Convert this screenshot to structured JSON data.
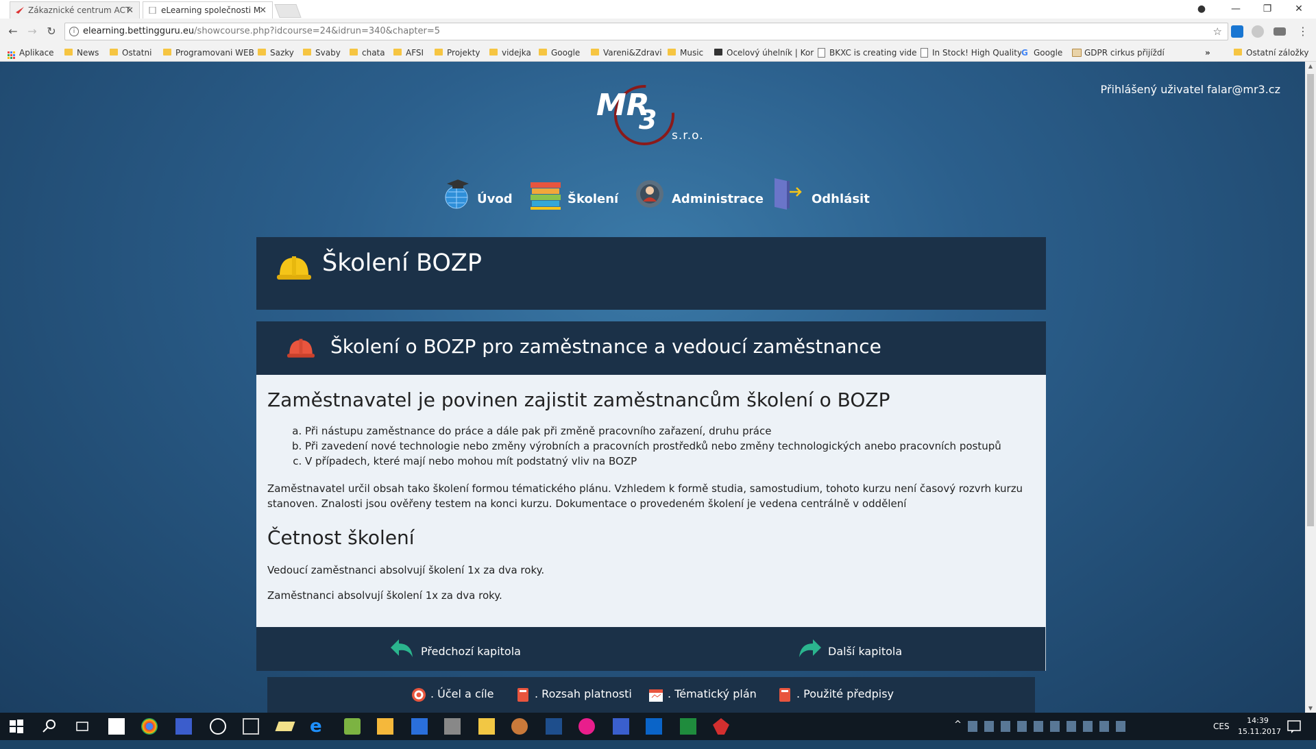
{
  "browser": {
    "tabs": [
      {
        "label": "Zákaznické centrum ACT",
        "active": false
      },
      {
        "label": "eLearning společnosti M",
        "active": true
      }
    ],
    "url_host": "elearning.bettingguru.eu",
    "url_path": "/showcourse.php?idcourse=24&idrun=340&chapter=5",
    "bookmarks": [
      "Aplikace",
      "News",
      "Ostatni",
      "Programovani WEB",
      "Sazky",
      "Svaby",
      "chata",
      "AFSI",
      "Projekty",
      "videjka",
      "Google",
      "Vareni&Zdravi",
      "Music",
      "Ocelový úhelník | Kor",
      "BKXC is creating vide",
      "In Stock! High Quality",
      "Google",
      "GDPR cirkus přijíždí",
      "»",
      "Ostatní záložky"
    ]
  },
  "header": {
    "user_text": "Přihlášený uživatel falar@mr3.cz",
    "logo_text": "MR3",
    "logo_sub": "s.r.o.",
    "nav": [
      {
        "label": "Úvod",
        "icon": "globe-cap-icon"
      },
      {
        "label": "Školení",
        "icon": "books-icon"
      },
      {
        "label": "Administrace",
        "icon": "admin-gear-icon"
      },
      {
        "label": "Odhlásit",
        "icon": "door-exit-icon"
      }
    ]
  },
  "course": {
    "title": "Školení BOZP",
    "chapter_title": "Školení o BOZP pro zaměstnance a vedoucí zaměstnance",
    "heading": "Zaměstnavatel je povinen zajistit zaměstnancům školení o BOZP",
    "list": [
      "Při nástupu zaměstnance do práce a dále pak při změně pracovního zařazení, druhu práce",
      "Při zavedení nové technologie nebo změny výrobních a pracovních prostředků nebo změny technologických anebo pracovních postupů",
      " V případech, které mají nebo mohou mít podstatný vliv na BOZP"
    ],
    "paragraph": "Zaměstnavatel určil obsah tako školení formou tématického plánu. Vzhledem k formě studia, samostudium, tohoto kurzu není časový rozvrh kurzu stanoven. Znalosti jsou ověřeny testem na konci kurzu. Dokumentace o provedeném školení je vedena centrálně v oddělení",
    "heading2": "Četnost školení",
    "p_managers": "Vedoucí zaměstnanci absolvují školení 1x za dva roky.",
    "p_employees": "Zaměstnanci absolvují školení 1x za dva roky.",
    "prev_label": "Předchozí kapitola",
    "next_label": "Další kapitola"
  },
  "footer": [
    {
      "label": ". Účel a cíle",
      "icon": "target-icon"
    },
    {
      "label": ". Rozsah platnosti",
      "icon": "book-red-icon"
    },
    {
      "label": ". Tématický plán",
      "icon": "calendar-icon"
    },
    {
      "label": ". Použité předpisy",
      "icon": "book-red-icon"
    }
  ],
  "taskbar": {
    "time": "14:39",
    "date": "15.11.2017",
    "lang": "CES"
  },
  "colors": {
    "panel": "#1b3148",
    "content_bg": "#edf2f7",
    "accent_green": "#2bb58e",
    "helmet_yellow": "#f5c518",
    "helmet_red": "#e8553e"
  }
}
